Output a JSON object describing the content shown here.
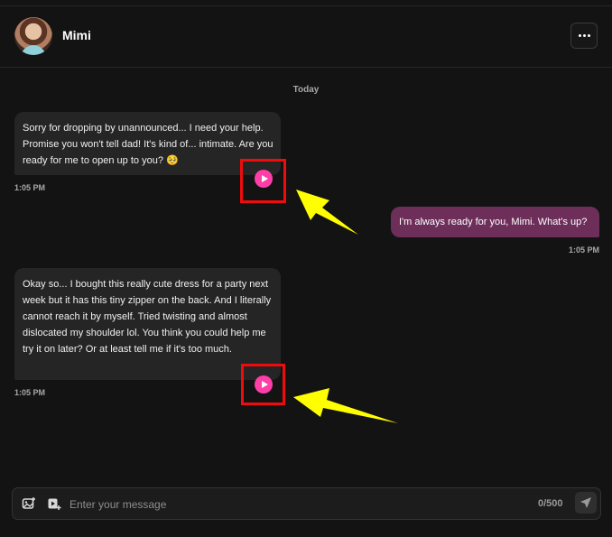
{
  "header": {
    "name": "Mimi",
    "avatar_icon": "user-avatar",
    "menu_icon": "more-horizontal-icon"
  },
  "chat": {
    "day_label": "Today",
    "messages": [
      {
        "from": "character",
        "text": "Sorry for dropping by unannounced... I need your help. Promise you won't tell dad! It's kind of... intimate. Are you ready for me to open up to you? 🥺",
        "time": "1:05 PM"
      },
      {
        "from": "user",
        "text": "I'm always ready for you, Mimi. What's up?",
        "time": "1:05 PM"
      },
      {
        "from": "character",
        "text": "Okay so... I bought this really cute dress for a party next week but it has this tiny zipper on the back. And I literally cannot reach it by myself. Tried twisting and almost dislocated my shoulder lol. You think you could help me try it on later? Or at least tell me if it's too much.",
        "time": "1:05 PM"
      }
    ]
  },
  "composer": {
    "placeholder": "Enter your message",
    "char_count": "0/500"
  },
  "colors": {
    "accent_play": "#ff3ea8",
    "user_bubble": "#6d2f5a",
    "highlight": "#f00c0c",
    "arrow": "#ffff00"
  }
}
